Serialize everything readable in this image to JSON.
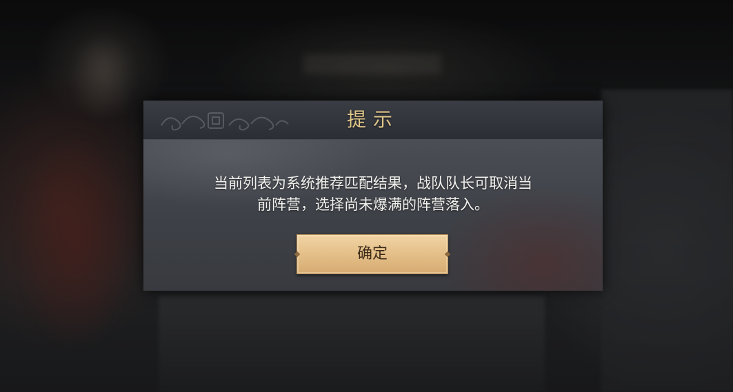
{
  "dialog": {
    "title": "提示",
    "message": "当前列表为系统推荐匹配结果，战队队长可取消当\n前阵营，选择尚未爆满的阵营落入。",
    "confirm_label": "确定"
  },
  "colors": {
    "title_gold": "#e0c68a",
    "button_fill": "#e3bd86",
    "button_text": "#3c2a18",
    "message_text": "#f1f1ee",
    "dialog_body": "#3e4147",
    "dialog_header": "#2b2e34"
  },
  "icons": {
    "header_ornament": "cloud-pattern-icon",
    "button_corner": "diamond-notch-icon"
  }
}
